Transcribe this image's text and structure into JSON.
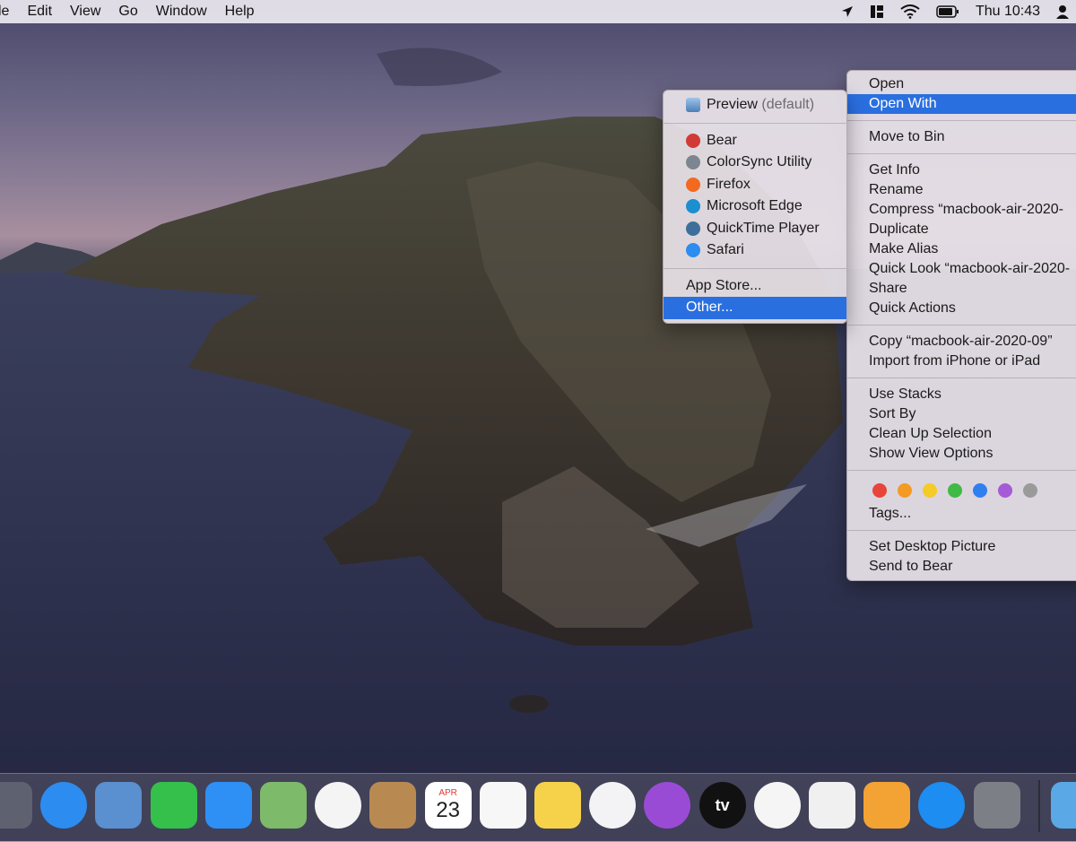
{
  "menubar": {
    "items": [
      "le",
      "Edit",
      "View",
      "Go",
      "Window",
      "Help"
    ],
    "clock": "Thu 10:43",
    "icons": [
      "location-arrow-icon",
      "layout-grid-icon",
      "wifi-icon",
      "battery-icon",
      "user-icon"
    ]
  },
  "context_menu": {
    "groups": [
      [
        "Open",
        "Open With"
      ],
      [
        "Move to Bin"
      ],
      [
        "Get Info",
        "Rename",
        "Compress “macbook-air-2020-",
        "Duplicate",
        "Make Alias",
        "Quick Look “macbook-air-2020-",
        "Share",
        "Quick Actions"
      ],
      [
        "Copy “macbook-air-2020-09”",
        "Import from iPhone or iPad"
      ],
      [
        "Use Stacks",
        "Sort By",
        "Clean Up Selection",
        "Show View Options"
      ]
    ],
    "highlighted": "Open With",
    "tags_label": "Tags...",
    "tag_colors": [
      "#e8443a",
      "#f59a22",
      "#f4cb27",
      "#3fba45",
      "#2f7ff0",
      "#a55bd5",
      "#9a9a9a"
    ],
    "bottom": [
      "Set Desktop Picture",
      "Send to Bear"
    ]
  },
  "open_with": {
    "default_app": "Preview",
    "default_suffix": "(default)",
    "apps": [
      {
        "name": "Bear",
        "icon": "bear-icon",
        "color": "#d13a36"
      },
      {
        "name": "ColorSync Utility",
        "icon": "colorsync-icon",
        "color": "#7c8590"
      },
      {
        "name": "Firefox",
        "icon": "firefox-icon",
        "color": "#f26a1f"
      },
      {
        "name": "Microsoft Edge",
        "icon": "edge-icon",
        "color": "#1b8fcf"
      },
      {
        "name": "QuickTime Player",
        "icon": "quicktime-icon",
        "color": "#3d6f9a"
      },
      {
        "name": "Safari",
        "icon": "safari-icon",
        "color": "#2d8cf0"
      }
    ],
    "extras": [
      "App Store...",
      "Other..."
    ],
    "highlighted": "Other..."
  },
  "dock": {
    "apps": [
      {
        "icon": "launchpad-icon",
        "color": "#5e6270"
      },
      {
        "icon": "safari-icon",
        "color": "#2d8cf0"
      },
      {
        "icon": "mail-icon",
        "color": "#5a8fd0"
      },
      {
        "icon": "facetime-icon",
        "color": "#34c04a"
      },
      {
        "icon": "messages-icon",
        "color": "#2e8ff5"
      },
      {
        "icon": "maps-icon",
        "color": "#7dba6a"
      },
      {
        "icon": "photos-icon",
        "color": "#f4f4f4"
      },
      {
        "icon": "contacts-icon",
        "color": "#b88a52"
      },
      {
        "icon": "calendar-icon",
        "color": "#ffffff",
        "month": "APR",
        "day": "23"
      },
      {
        "icon": "reminders-icon",
        "color": "#f7f7f7"
      },
      {
        "icon": "notes-icon",
        "color": "#f6d24a"
      },
      {
        "icon": "music-icon",
        "color": "#f3f3f5"
      },
      {
        "icon": "podcasts-icon",
        "color": "#9a4bd6"
      },
      {
        "icon": "tv-icon",
        "color": "#111111",
        "label": "tv"
      },
      {
        "icon": "news-icon",
        "color": "#f5f5f5"
      },
      {
        "icon": "numbers-icon",
        "color": "#f0f0f0"
      },
      {
        "icon": "pages-icon",
        "color": "#f3a334"
      },
      {
        "icon": "app-store-icon",
        "color": "#1d8df2"
      },
      {
        "icon": "system-preferences-icon",
        "color": "#7c7f86"
      }
    ],
    "trailing": {
      "icon": "folder-icon",
      "color": "#5aa9e6"
    }
  }
}
